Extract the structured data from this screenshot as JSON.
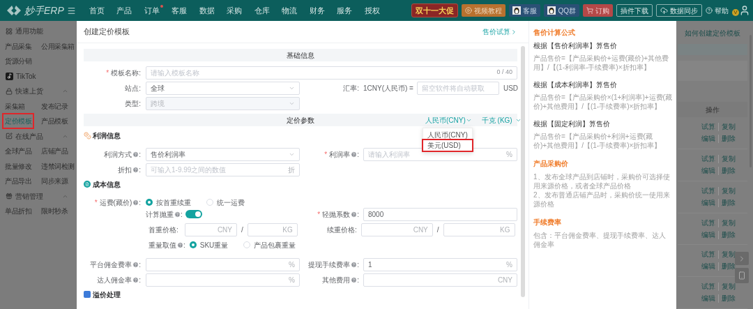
{
  "topbar": {
    "logo": "妙手ERP",
    "nav": [
      {
        "label": "首页",
        "badge": false
      },
      {
        "label": "产品",
        "badge": false
      },
      {
        "label": "订单",
        "badge": true
      },
      {
        "label": "客服",
        "badge": false
      },
      {
        "label": "数据",
        "badge": false
      },
      {
        "label": "采购",
        "badge": false
      },
      {
        "label": "仓库",
        "badge": false
      },
      {
        "label": "物流",
        "badge": false
      },
      {
        "label": "财务",
        "badge": false
      },
      {
        "label": "服务",
        "badge": false
      },
      {
        "label": "授权",
        "badge": false
      }
    ],
    "tools": [
      {
        "kind": "promo",
        "label": "双十一大促"
      },
      {
        "kind": "video",
        "label": "视频教程"
      },
      {
        "kind": "qq",
        "label": "客服"
      },
      {
        "kind": "qq",
        "label": "QQ群"
      },
      {
        "kind": "order",
        "label": "订购"
      },
      {
        "kind": "outline",
        "label": "插件下载"
      },
      {
        "kind": "cloud",
        "label": "数据同步"
      },
      {
        "kind": "help",
        "label": "帮助"
      }
    ],
    "vip_badge": "V"
  },
  "sidebar": [
    {
      "kind": "plain",
      "title": "通用功能",
      "items": [
        {
          "label": "产品采集",
          "selected": false,
          "outlined": false
        },
        {
          "label": "公用采集箱",
          "selected": false,
          "outlined": false
        },
        {
          "label": "货源分销",
          "selected": false,
          "outlined": false
        }
      ]
    },
    {
      "kind": "plain",
      "title": "TikTok"
    },
    {
      "kind": "group",
      "title": "快速上货",
      "expanded": true,
      "items": [
        {
          "label": "采集箱",
          "selected": false,
          "outlined": false
        },
        {
          "label": "发布记录",
          "selected": false,
          "outlined": false
        },
        {
          "label": "定价模板",
          "selected": true,
          "outlined": true
        },
        {
          "label": "产品模板",
          "selected": false,
          "outlined": false
        }
      ]
    },
    {
      "kind": "group",
      "title": "在线产品",
      "expanded": true,
      "items": [
        {
          "label": "全球产品",
          "selected": false,
          "outlined": false
        },
        {
          "label": "店铺产品",
          "selected": false,
          "outlined": false
        },
        {
          "label": "批量修改",
          "selected": false,
          "outlined": false
        },
        {
          "label": "违禁词检测",
          "selected": false,
          "outlined": false
        },
        {
          "label": "产品导出",
          "selected": false,
          "outlined": false
        },
        {
          "label": "同步来源",
          "selected": false,
          "outlined": false
        }
      ]
    },
    {
      "kind": "group",
      "title": "营销管理",
      "expanded": true,
      "items": [
        {
          "label": "单品折扣",
          "selected": false,
          "outlined": false
        },
        {
          "label": "限时秒杀",
          "selected": false,
          "outlined": false
        }
      ]
    }
  ],
  "dialog": {
    "title": "创建定价模板",
    "link": "售价试算",
    "basic": {
      "heading": "基础信息",
      "template_name": {
        "required_mark": "*",
        "label": "模板名称",
        "colon": ":",
        "placeholder": "请输入模板名称",
        "counter": "0 / 40"
      },
      "site": {
        "kind": "select",
        "label": "站点",
        "colon": ":",
        "value": "全球",
        "disabled": false
      },
      "exchange": {
        "label": "汇率",
        "colon": ":",
        "prefix": "1CNY(人民币) =",
        "placeholder": "留空软件将自动获取",
        "suffix": "USD"
      },
      "type": {
        "kind": "select",
        "label": "类型",
        "colon": ":",
        "value": "跨境",
        "disabled": true
      }
    },
    "pricing": {
      "heading": "定价参数",
      "currency": "人民币(CNY)",
      "unit": "千克 (KG)",
      "currency_menu": [
        {
          "label": "人民币(CNY)",
          "outlined": false
        },
        {
          "label": "美元(USD)",
          "outlined": true
        }
      ]
    },
    "profit": {
      "title": "利润信息",
      "method": {
        "kind": "select",
        "label": "利润方式",
        "colon": ":",
        "help": true,
        "value": "售价利润率",
        "disabled": false
      },
      "rate": {
        "required_mark": "*",
        "label": "利润率",
        "colon": ":",
        "help": true,
        "placeholder": "请输入利润率",
        "suffix": "%"
      },
      "discount": {
        "label": "折扣",
        "colon": ":",
        "help": true,
        "placeholder": "可输入1-9.99之间的数值",
        "suffix": "折"
      }
    },
    "cost": {
      "title": "成本信息",
      "shipping": {
        "required_mark": "*",
        "label": "运费(藏价)",
        "colon": ":",
        "help": true,
        "options": [
          {
            "label": "按首重续重",
            "selected": true
          },
          {
            "label": "统一运费",
            "selected": false
          }
        ]
      },
      "volumetric": {
        "label": "计算抛重",
        "colon": ":",
        "help": true,
        "on": true
      },
      "factor": {
        "required_mark": "*",
        "label": "轻抛系数",
        "colon": ":",
        "help": true,
        "value": "8000"
      },
      "first_weight": {
        "label": "首重价格",
        "colon": ":",
        "suffix": "CNY",
        "separator": "/",
        "unit_suffix": "KG"
      },
      "extra_weight": {
        "label": "续重价格",
        "colon": ":",
        "suffix": "CNY",
        "separator": "/",
        "unit_suffix": "KG"
      },
      "weight_basis": {
        "label": "重量取值",
        "colon": ":",
        "help": true,
        "options": [
          {
            "label": "SKU重量",
            "selected": true
          },
          {
            "label": "产品包裹重量",
            "selected": false
          }
        ]
      },
      "platform_fee": {
        "label": "平台佣金费率",
        "colon": ":",
        "help": true,
        "suffix": "%"
      },
      "withdraw_fee": {
        "label": "提现手续费率",
        "colon": ":",
        "help": true,
        "value": "1",
        "suffix": "%"
      },
      "influencer_fee": {
        "label": "达人佣金率",
        "colon": ":",
        "help": true,
        "suffix": "%"
      },
      "other_fee": {
        "label": "其他费用",
        "colon": ":",
        "help": true,
        "suffix": "CNY"
      }
    },
    "premium_title": "溢价处理"
  },
  "formula": {
    "title": "售价计算公式",
    "rules": [
      {
        "heading": "根据【售价利润率】算售价",
        "text": "产品售价=【产品采购价+运费(藏价)+其他费用】/【(1-利润率-手续费率)×折扣率】"
      },
      {
        "heading": "根据【成本利润率】算售价",
        "text": "产品售价=【产品采购价×(1+利润率)+运费(藏价)+其他费用】/【(1-手续费率)×折扣率】"
      },
      {
        "heading": "根据【固定利润】算售价",
        "text": "产品售价=【产品采购价+利润+运费(藏价)+其他费用】/【(1-手续费率)×折扣率】"
      }
    ],
    "notes": [
      {
        "title": "产品采购价",
        "lines": [
          "1、发布全球产品到店铺时，采购价可选择使用来源价格，或者全球产品价格",
          "2、发布普通店铺产品时，采购价统一使用来源价格"
        ]
      },
      {
        "title": "手续费率",
        "lines": [
          "包含：平台佣金费率、提现手续费率、达人佣金率"
        ]
      }
    ]
  },
  "page": {
    "help_link": "如何创建定价模板",
    "column": "操作",
    "rows": [
      {
        "actions": [
          "试算",
          "复制",
          "编辑",
          "删除"
        ]
      },
      {
        "actions": [
          "试算",
          "复制",
          "编辑",
          "删除"
        ]
      },
      {
        "actions": [
          "试算",
          "复制",
          "编辑",
          "删除"
        ]
      },
      {
        "actions": [
          "试算",
          "复制",
          "编辑",
          "删除"
        ]
      },
      {
        "actions": [
          "试算",
          "复制",
          "编辑",
          "删除"
        ]
      },
      {
        "actions": [
          "试算",
          "复制",
          "编辑",
          "删除"
        ]
      }
    ]
  }
}
